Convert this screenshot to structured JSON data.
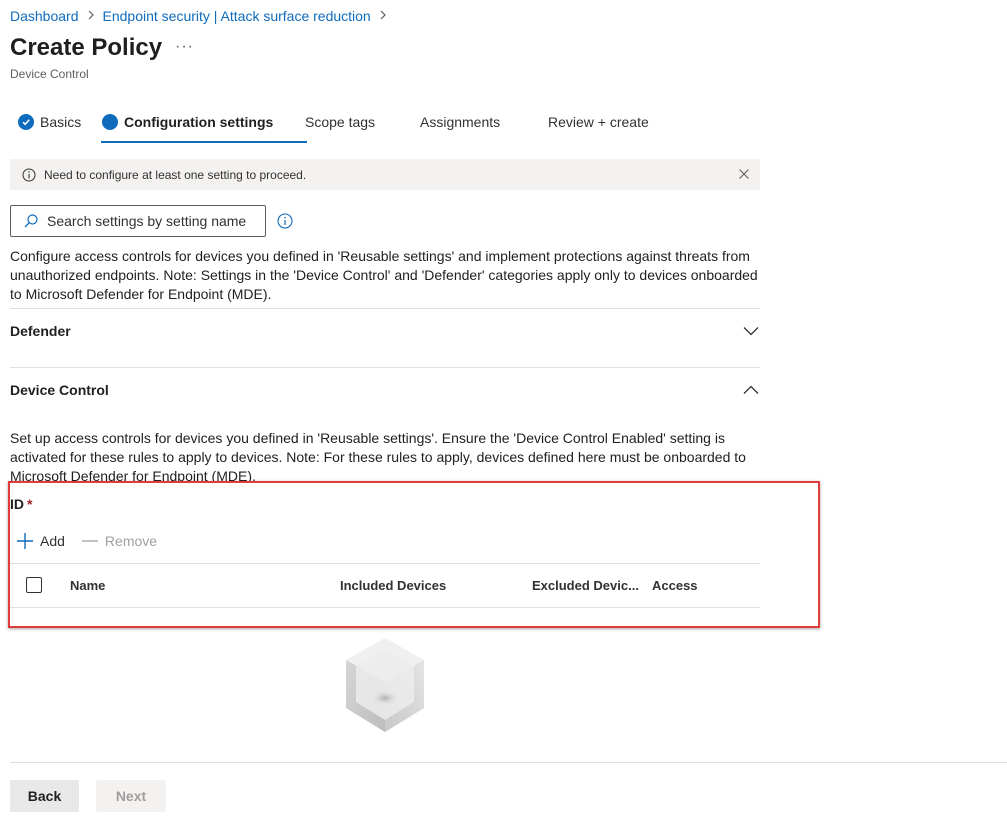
{
  "breadcrumb": {
    "items": [
      "Dashboard",
      "Endpoint security | Attack surface reduction"
    ]
  },
  "page": {
    "title": "Create Policy",
    "subtitle": "Device Control"
  },
  "wizard": {
    "tabs": [
      {
        "label": "Basics",
        "state": "completed"
      },
      {
        "label": "Configuration settings",
        "state": "active"
      },
      {
        "label": "Scope tags",
        "state": "pending"
      },
      {
        "label": "Assignments",
        "state": "pending"
      },
      {
        "label": "Review + create",
        "state": "pending"
      }
    ]
  },
  "infobar": {
    "message": "Need to configure at least one setting to proceed."
  },
  "search": {
    "placeholder": "Search settings by setting name"
  },
  "description": "Configure access controls for devices you defined in 'Reusable settings' and implement protections against threats from unauthorized endpoints. Note: Settings in the 'Device Control' and 'Defender' categories apply only to devices onboarded to Microsoft Defender for Endpoint (MDE).",
  "sections": [
    {
      "title": "Defender",
      "expanded": false
    },
    {
      "title": "Device Control",
      "expanded": true
    }
  ],
  "device_control": {
    "description": "Set up access controls for devices you defined in 'Reusable settings'. Ensure the 'Device Control Enabled' setting is activated for these rules to apply to devices. Note: For these rules to apply, devices defined here must be onboarded to Microsoft Defender for Endpoint (MDE).",
    "field_label": "ID",
    "required_marker": "*",
    "commands": {
      "add": "Add",
      "remove": "Remove"
    },
    "columns": [
      "Name",
      "Included Devices",
      "Excluded Devic...",
      "Access"
    ]
  },
  "footer": {
    "back": "Back",
    "next": "Next"
  },
  "colors": {
    "accent": "#0f6cbd",
    "highlight": "#e03c3c",
    "required": "#a4262c"
  }
}
